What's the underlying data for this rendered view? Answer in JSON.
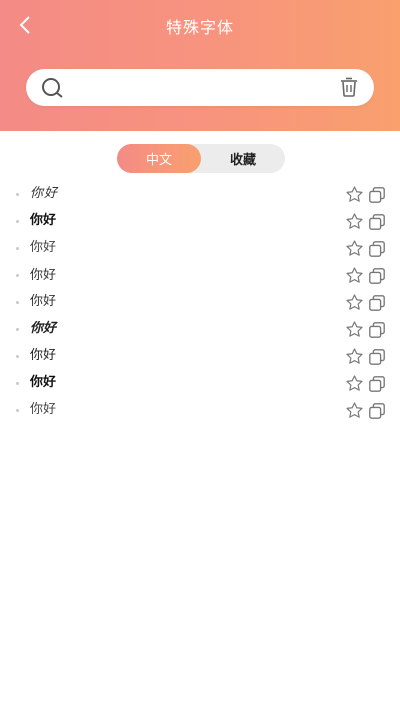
{
  "header": {
    "title": "特殊字体",
    "back_icon": "chevron-left-icon"
  },
  "search": {
    "value": "",
    "placeholder": "",
    "search_icon": "search-icon",
    "clear_icon": "trash-icon"
  },
  "tabs": [
    {
      "label": "中文",
      "active": true
    },
    {
      "label": "收藏",
      "active": false
    }
  ],
  "fonts": [
    {
      "text": "你好"
    },
    {
      "text": "你好"
    },
    {
      "text": "你好"
    },
    {
      "text": "你好"
    },
    {
      "text": "你好"
    },
    {
      "text": "你好"
    },
    {
      "text": "你好"
    },
    {
      "text": "你好"
    },
    {
      "text": "你好"
    }
  ],
  "colors": {
    "gradient_start": "#f48b86",
    "gradient_end": "#f9a06e",
    "tab_background": "#ececec"
  }
}
